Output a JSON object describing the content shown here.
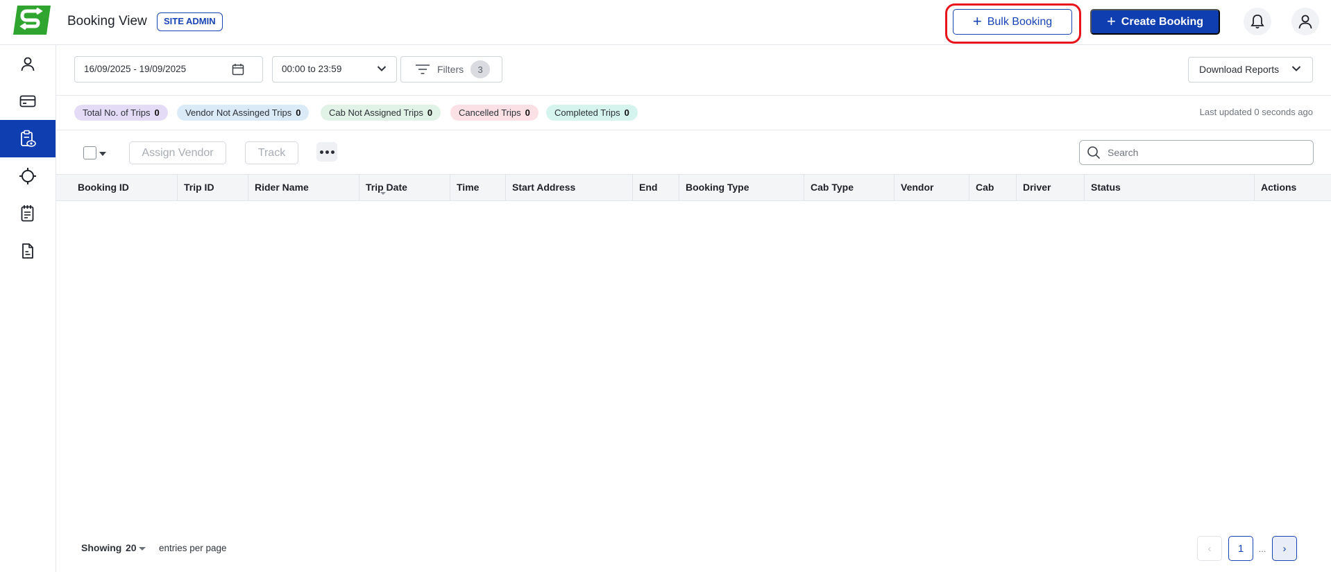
{
  "header": {
    "title": "Booking View",
    "role_badge": "SITE ADMIN",
    "bulk_booking_label": "Bulk Booking",
    "create_booking_label": "Create Booking",
    "plus_glyph": "+"
  },
  "sidebar": {
    "items": [
      {
        "icon": "user-icon",
        "active": false
      },
      {
        "icon": "card-icon",
        "active": false
      },
      {
        "icon": "clipboard-eye-icon",
        "active": true
      },
      {
        "icon": "crosshair-icon",
        "active": false
      },
      {
        "icon": "checklist-icon",
        "active": false
      },
      {
        "icon": "document-icon",
        "active": false
      }
    ]
  },
  "filters": {
    "date_range": "16/09/2025 - 19/09/2025",
    "time_range": "00:00 to 23:59",
    "filters_label": "Filters",
    "filters_count": "3",
    "download_label": "Download Reports"
  },
  "summary": {
    "chips": [
      {
        "label": "Total No. of Trips",
        "count": "0",
        "color": "#e4dcf6"
      },
      {
        "label": "Vendor Not Assinged Trips",
        "count": "0",
        "color": "#dbeaf7"
      },
      {
        "label": "Cab Not Assigned Trips",
        "count": "0",
        "color": "#e1f3e6"
      },
      {
        "label": "Cancelled Trips",
        "count": "0",
        "color": "#fbe1e5"
      },
      {
        "label": "Completed Trips",
        "count": "0",
        "color": "#d5f4ee"
      }
    ],
    "last_updated": "Last updated 0 seconds ago"
  },
  "actions": {
    "assign_vendor_label": "Assign Vendor",
    "track_label": "Track",
    "search_placeholder": "Search"
  },
  "table": {
    "columns": [
      "Booking ID",
      "Trip ID",
      "Rider Name",
      "Trip Date",
      "Time",
      "Start Address",
      "End",
      "Booking Type",
      "Cab Type",
      "Vendor",
      "Cab",
      "Driver",
      "Status",
      "Actions"
    ],
    "rows": []
  },
  "footer": {
    "showing_label": "Showing",
    "page_size": "20",
    "per_page_label": "entries per page",
    "current_page": "1",
    "dots": "...",
    "prev_glyph": "‹",
    "next_glyph": "›"
  },
  "colors": {
    "brand_blue": "#0f3eb0",
    "highlight_red": "#e8141b",
    "logo_green": "#2fa52f"
  }
}
